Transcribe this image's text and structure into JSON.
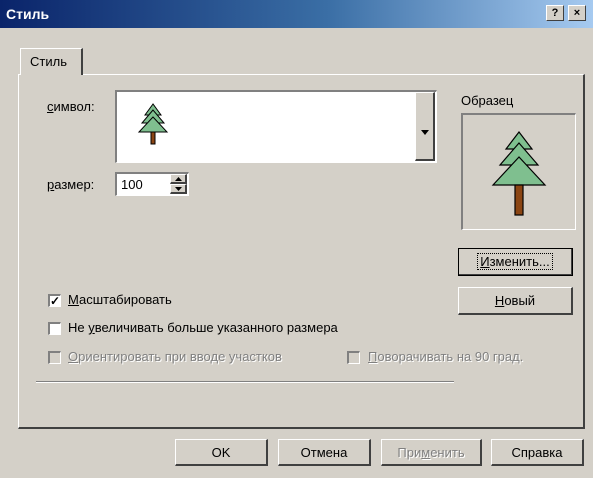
{
  "window": {
    "title": "Стиль",
    "help_button": "?",
    "close_button": "×"
  },
  "tab": {
    "label": "Стиль"
  },
  "symbol": {
    "label": "символ:",
    "hotkey": "с",
    "rest": "имвол:",
    "icon": "tree-icon"
  },
  "size": {
    "label": "размер:",
    "hotkey": "р",
    "rest": "азмер:",
    "value": "100"
  },
  "preview": {
    "label": "Образец",
    "icon": "tree-icon"
  },
  "buttons": {
    "change": {
      "label": "Изменить...",
      "hotkey": "И",
      "rest": "зменить..."
    },
    "new": {
      "label": "Новый",
      "hotkey": "Н",
      "rest": "овый"
    }
  },
  "checkboxes": {
    "scale": {
      "label": "Масштабировать",
      "hotkey": "М",
      "rest": "асштабировать",
      "checked": true,
      "enabled": true
    },
    "no_enlarge": {
      "label": "Не увеличивать больше указанного размера",
      "pre": "Не ",
      "hotkey": "у",
      "rest": "величивать больше указанного размера",
      "checked": false,
      "enabled": true
    },
    "orient": {
      "label": "Ориентировать при вводе участков",
      "hotkey": "О",
      "rest": "риентировать при вводе участков",
      "checked": false,
      "enabled": false
    },
    "rotate": {
      "label": "Поворачивать на 90 град.",
      "hotkey": "П",
      "rest": "оворачивать на 90 град.",
      "checked": false,
      "enabled": false
    }
  },
  "footer": {
    "ok": "OK",
    "cancel": "Отмена",
    "apply": {
      "label": "Применить",
      "pre": "При",
      "hotkey": "м",
      "rest": "енить",
      "enabled": false
    },
    "help": "Справка"
  },
  "colors": {
    "tree_foliage": "#7fbf8f",
    "tree_trunk": "#8b4513",
    "title_start": "#0a246a",
    "title_end": "#a6caf0",
    "face": "#d4d0c8"
  }
}
